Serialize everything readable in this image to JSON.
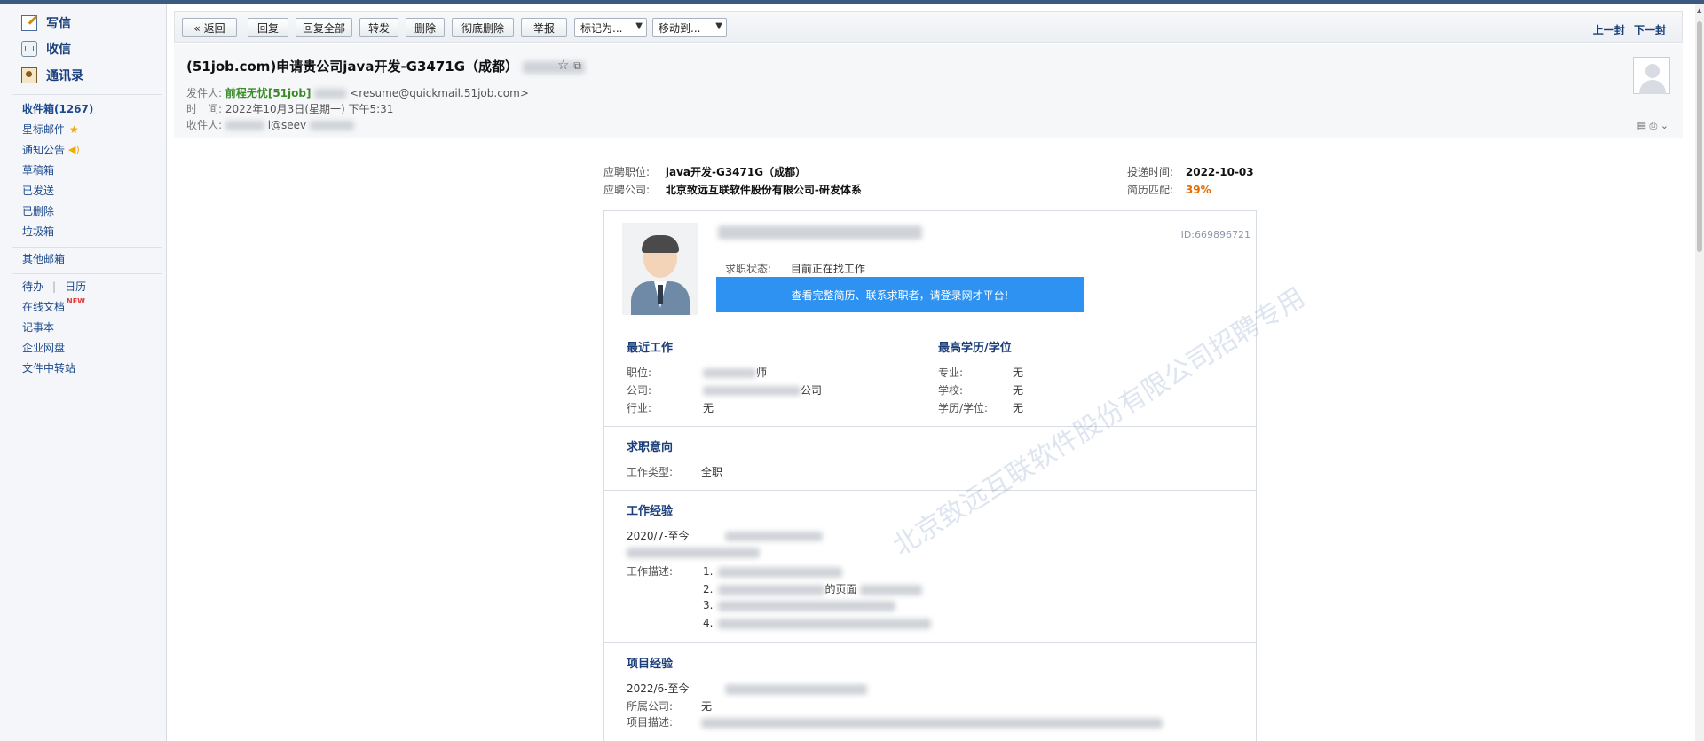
{
  "sidebar": {
    "write": "写信",
    "inbox": "收信",
    "contacts": "通讯录",
    "folders": [
      "收件箱(1267)",
      "星标邮件",
      "通知公告",
      "草稿箱",
      "已发送",
      "已删除",
      "垃圾箱"
    ],
    "other_mailbox": "其他邮箱",
    "todo": "待办",
    "calendar": "日历",
    "tools": [
      "在线文档",
      "记事本",
      "企业网盘",
      "文件中转站"
    ],
    "new_tag": "NEW"
  },
  "toolbar": {
    "back": "« 返回",
    "reply": "回复",
    "reply_all": "回复全部",
    "forward": "转发",
    "delete": "删除",
    "delete_perm": "彻底删除",
    "report": "举报",
    "mark_as": "标记为...",
    "move_to": "移动到...",
    "prev": "上一封",
    "next": "下一封"
  },
  "mail": {
    "subject": "(51job.com)申请贵公司java开发-G3471G（成都）",
    "sender_label": "发件人:",
    "sender_name": "前程无忧[51job]",
    "sender_email": "<resume@quickmail.51job.com>",
    "time_label": "时　间:",
    "time_value": "2022年10月3日(星期一) 下午5:31",
    "recipient_label": "收件人:",
    "recipient_value": "i@seev"
  },
  "job": {
    "position_label": "应聘职位:",
    "position_value": "java开发-G3471G（成都）",
    "company_label": "应聘公司:",
    "company_value": "北京致远互联软件股份有限公司-研发体系",
    "submit_label": "投递时间:",
    "submit_value": "2022-10-03",
    "match_label": "简历匹配:",
    "match_value": "39%"
  },
  "resume": {
    "id": "ID:669896721",
    "status_label": "求职状态:",
    "status_value": "目前正在找工作",
    "cta": "查看完整简历、联系求职者，请登录网才平台!",
    "recent_work_title": "最近工作",
    "rw_position_label": "职位:",
    "rw_position_value": "师",
    "rw_company_label": "公司:",
    "rw_company_value": "公司",
    "rw_industry_label": "行业:",
    "rw_industry_value": "无",
    "edu_title": "最高学历/学位",
    "edu_major_label": "专业:",
    "edu_major_value": "无",
    "edu_school_label": "学校:",
    "edu_school_value": "无",
    "edu_degree_label": "学历/学位:",
    "edu_degree_value": "无",
    "intent_title": "求职意向",
    "intent_type_label": "工作类型:",
    "intent_type_value": "全职",
    "exp_title": "工作经验",
    "exp_period": "2020/7-至今",
    "exp_desc_label": "工作描述:",
    "exp_items": [
      "1.",
      "2.",
      "3.",
      "4."
    ],
    "exp_frag": "的页面",
    "proj_title": "项目经验",
    "proj_period": "2022/6-至今",
    "proj_company_label": "所属公司:",
    "proj_company_value": "无",
    "proj_desc_label": "项目描述:"
  },
  "watermark": "北京致远互联软件股份有限公司招聘专用"
}
